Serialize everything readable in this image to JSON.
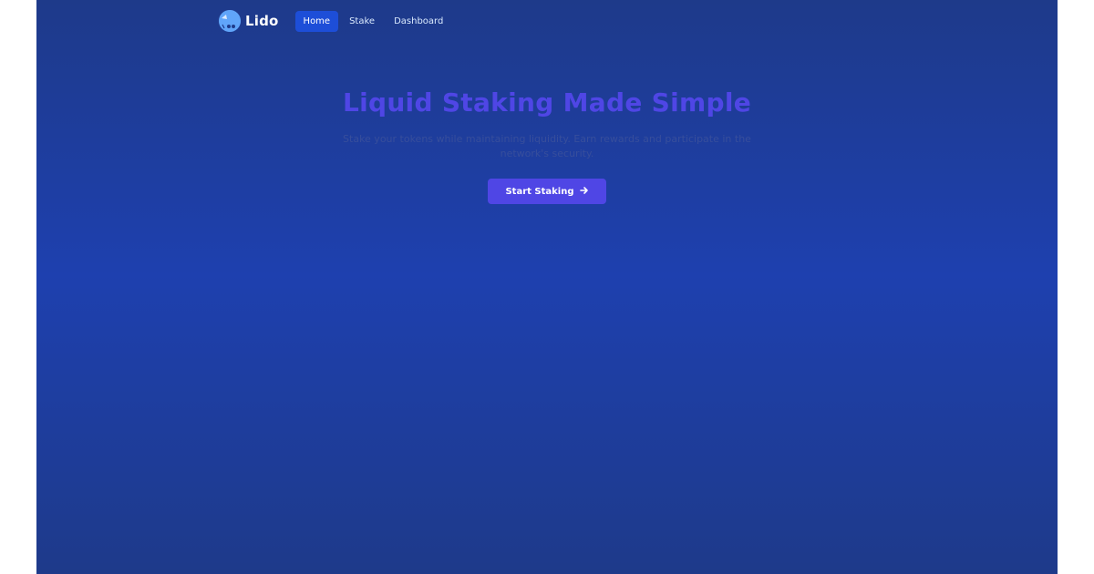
{
  "brand": {
    "name": "Lido",
    "icon": "lido-logo-icon"
  },
  "nav": {
    "items": [
      {
        "label": "Home",
        "active": true
      },
      {
        "label": "Stake",
        "active": false
      },
      {
        "label": "Dashboard",
        "active": false
      }
    ]
  },
  "hero": {
    "title": "Liquid Staking Made Simple",
    "subtitle_line1": "Stake your tokens while maintaining liquidity. Earn rewards and participate in the",
    "subtitle_line2": "network's security.",
    "cta_label": "Start Staking",
    "cta_icon": "arrow-right-icon"
  },
  "colors": {
    "background_top": "#1e3a8a",
    "background_mid": "#1e40af",
    "accent": "#4f46e5",
    "nav_active": "#1d4ed8",
    "logo": "#60a5fa"
  }
}
